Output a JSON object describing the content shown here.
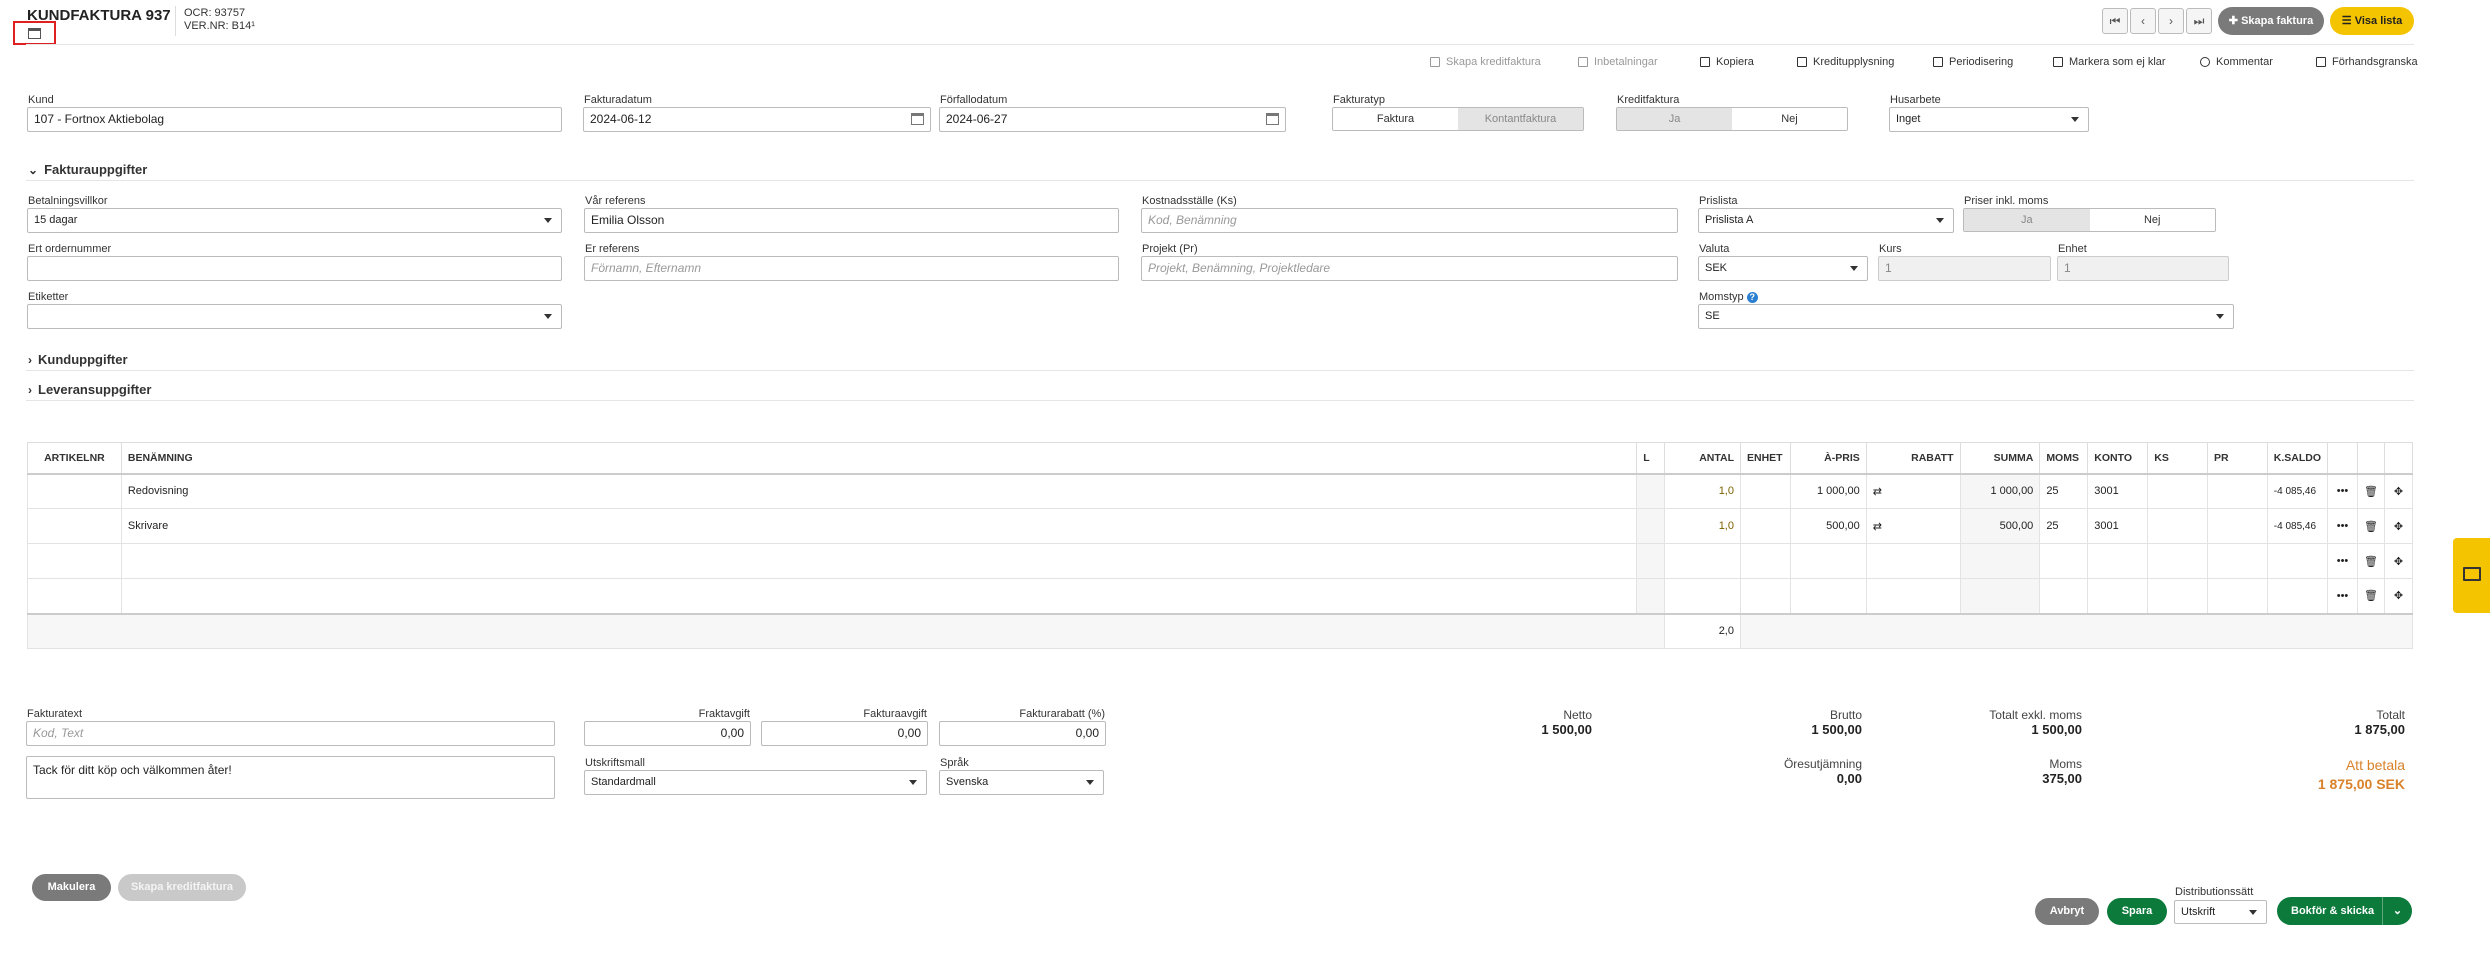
{
  "header": {
    "title": "KUNDFAKTURA 937",
    "ocr": "OCR: 93757",
    "vernr": "VER.NR: B14¹",
    "nav": [
      "⏮",
      "‹",
      "›",
      "⏭"
    ],
    "create_invoice": "Skapa faktura",
    "show_list": "Visa lista"
  },
  "toolbar": {
    "create_credit": "Skapa kreditfaktura",
    "payments": "Inbetalningar",
    "copy": "Kopiera",
    "credit_info": "Kreditupplysning",
    "periodize": "Periodisering",
    "mark_not_ready": "Markera som ej klar",
    "comment": "Kommentar",
    "preview": "Förhandsgranska"
  },
  "top": {
    "customer_label": "Kund",
    "customer_value": "107 - Fortnox Aktiebolag",
    "invoice_date_label": "Fakturadatum",
    "invoice_date_value": "2024-06-12",
    "due_date_label": "Förfallodatum",
    "due_date_value": "2024-06-27",
    "invoice_type_label": "Fakturatyp",
    "invoice_type_options": [
      "Faktura",
      "Kontantfaktura"
    ],
    "credit_label": "Kreditfaktura",
    "credit_options": [
      "Ja",
      "Nej"
    ],
    "husarbete_label": "Husarbete",
    "husarbete_value": "Inget"
  },
  "sections": {
    "invoice_details": "Fakturauppgifter",
    "customer_details": "Kunduppgifter",
    "delivery_details": "Leveransuppgifter"
  },
  "details": {
    "payment_terms_label": "Betalningsvillkor",
    "payment_terms_value": "15 dagar",
    "our_ref_label": "Vår referens",
    "our_ref_value": "Emilia Olsson",
    "cost_center_label": "Kostnadsställe (Ks)",
    "cost_center_placeholder": "Kod, Benämning",
    "pricelist_label": "Prislista",
    "pricelist_value": "Prislista A",
    "prices_incl_vat_label": "Priser inkl. moms",
    "prices_incl_vat_options": [
      "Ja",
      "Nej"
    ],
    "order_no_label": "Ert ordernummer",
    "your_ref_label": "Er referens",
    "your_ref_placeholder": "Förnamn, Efternamn",
    "project_label": "Projekt (Pr)",
    "project_placeholder": "Projekt, Benämning, Projektledare",
    "currency_label": "Valuta",
    "currency_value": "SEK",
    "rate_label": "Kurs",
    "rate_value": "1",
    "unit_label": "Enhet",
    "unit_value": "1",
    "tags_label": "Etiketter",
    "vat_type_label": "Momstyp",
    "vat_type_value": "SE"
  },
  "table": {
    "headers": [
      "ARTIKELNR",
      "BENÄMNING",
      "L",
      "ANTAL",
      "ENHET",
      "À-PRIS",
      "RABATT",
      "SUMMA",
      "MOMS",
      "KONTO",
      "KS",
      "PR",
      "K.SALDO"
    ],
    "rows": [
      {
        "artnr": "",
        "name": "Redovisning",
        "qty": "1,0",
        "unit": "",
        "price": "1 000,00",
        "sum": "1 000,00",
        "vat": "25",
        "account": "3001",
        "balance": "-4 085,46"
      },
      {
        "artnr": "",
        "name": "Skrivare",
        "qty": "1,0",
        "unit": "",
        "price": "500,00",
        "sum": "500,00",
        "vat": "25",
        "account": "3001",
        "balance": "-4 085,46"
      }
    ],
    "total_qty": "2,0"
  },
  "footer": {
    "invoice_text_label": "Fakturatext",
    "invoice_text_placeholder": "Kod, Text",
    "thanks_text": "Tack för ditt köp och välkommen åter!",
    "freight_label": "Fraktavgift",
    "freight_value": "0,00",
    "invoice_fee_label": "Fakturaavgift",
    "invoice_fee_value": "0,00",
    "discount_label": "Fakturarabatt (%)",
    "discount_value": "0,00",
    "template_label": "Utskriftsmall",
    "template_value": "Standardmall",
    "language_label": "Språk",
    "language_value": "Svenska"
  },
  "summary": {
    "net_label": "Netto",
    "net_value": "1 500,00",
    "gross_label": "Brutto",
    "gross_value": "1 500,00",
    "excl_label": "Totalt exkl. moms",
    "excl_value": "1 500,00",
    "total_label": "Totalt",
    "total_value": "1 875,00",
    "rounding_label": "Öresutjämning",
    "rounding_value": "0,00",
    "vat_label": "Moms",
    "vat_value": "375,00",
    "to_pay_label": "Att betala",
    "to_pay_value": "1 875,00 SEK"
  },
  "actions": {
    "void": "Makulera",
    "create_credit": "Skapa kreditfaktura",
    "cancel": "Avbryt",
    "save": "Spara",
    "distribution_label": "Distributionssätt",
    "distribution_value": "Utskrift",
    "book_send": "Bokför & skicka"
  },
  "colors": {
    "yellow": "#f5c400",
    "green": "#0b7a3b",
    "orange": "#d9822b",
    "gray": "#7a7a7a"
  }
}
